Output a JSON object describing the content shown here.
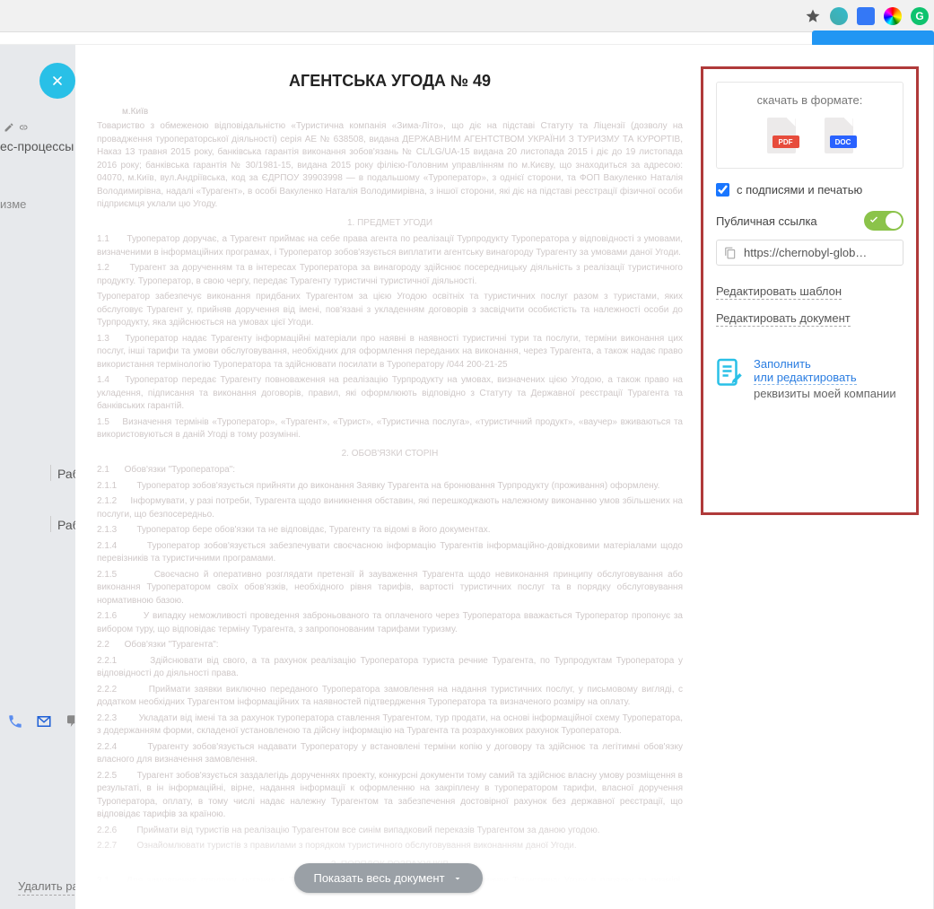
{
  "browser": {
    "ext_grammarly": "G"
  },
  "background": {
    "section_label": "ес-процессы",
    "changes_label": "изме",
    "side_item_1": "Раб",
    "side_item_2": "Раб",
    "delete_label": "Удалить ра"
  },
  "document": {
    "title": "АГЕНТСЬКА УГОДА № 49",
    "city": "м.Київ",
    "sections": {
      "s1": "1. ПРЕДМЕТ УГОДИ",
      "s2": "2. ОБОВ'ЯЗКИ СТОРІН",
      "s2a": "Обов'язки \"Туроператора\":",
      "s2b": "Обов'язки \"Турагента\":",
      "s3": "3. ПОРЯДОК РОЗРАХУНКІВ"
    },
    "show_all": "Показать весь документ"
  },
  "sidebar": {
    "download_title": "скачать в формате:",
    "formats": {
      "pdf": "PDF",
      "doc": "DOC"
    },
    "signatures_checkbox": "с подписями и печатью",
    "signatures_checked": true,
    "public_link_label": "Публичная ссылка",
    "public_link_url": "https://chernobyl-glob…",
    "edit_template": "Редактировать шаблон",
    "edit_document": "Редактировать документ",
    "fill_link_1": "Заполнить",
    "fill_link_2": "или редактировать",
    "fill_sub": "реквизиты моей компании"
  }
}
